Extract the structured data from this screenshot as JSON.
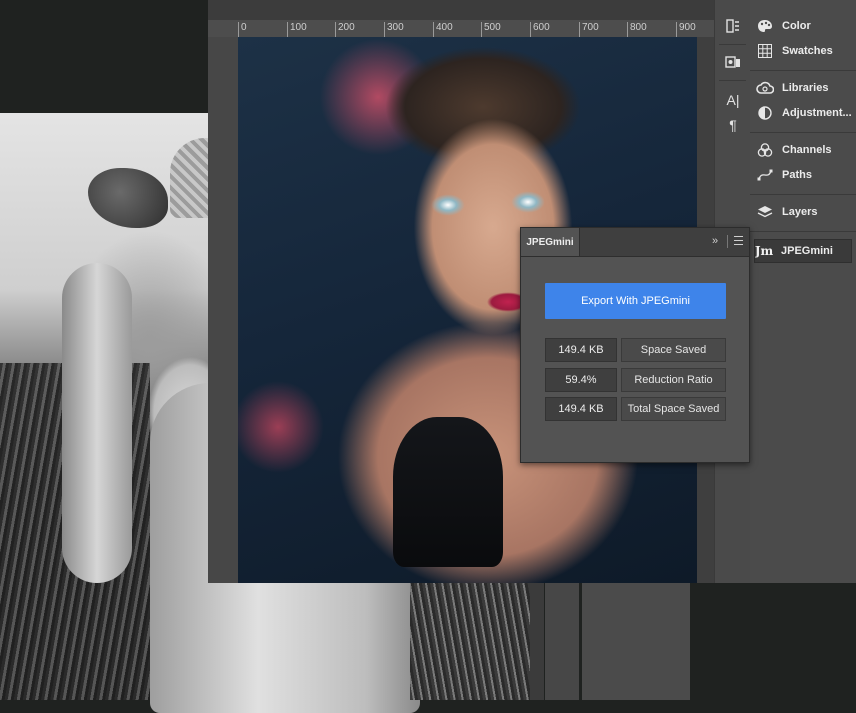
{
  "ruler": {
    "ticks": [
      "0",
      "100",
      "200",
      "300",
      "400",
      "500",
      "600",
      "700",
      "800",
      "900"
    ]
  },
  "tool_column": {
    "icons": [
      "adjust-panel-icon",
      "device-preview-icon",
      "character-icon",
      "paragraph-icon"
    ],
    "character_glyph": "A|",
    "paragraph_glyph": "¶"
  },
  "dock": {
    "items": [
      {
        "label": "Color",
        "icon": "palette-icon"
      },
      {
        "label": "Swatches",
        "icon": "grid-icon"
      },
      {
        "label": "Libraries",
        "icon": "cc-libraries-icon"
      },
      {
        "label": "Adjustment...",
        "icon": "adjustments-icon"
      },
      {
        "label": "Channels",
        "icon": "channels-icon"
      },
      {
        "label": "Paths",
        "icon": "paths-icon"
      },
      {
        "label": "Layers",
        "icon": "layers-icon"
      },
      {
        "label": "JPEGmini",
        "icon": "jpegmini-icon",
        "glyph": "Jm",
        "active": true
      }
    ]
  },
  "jpegmini": {
    "tab_label": "JPEGmini",
    "collapse_glyph": "»",
    "export_button": "Export With JPEGmini",
    "stats": [
      {
        "value": "149.4 KB",
        "label": "Space Saved"
      },
      {
        "value": "59.4%",
        "label": "Reduction Ratio"
      },
      {
        "value": "149.4 KB",
        "label": "Total Space Saved"
      }
    ],
    "accent_color": "#3e84ea"
  }
}
